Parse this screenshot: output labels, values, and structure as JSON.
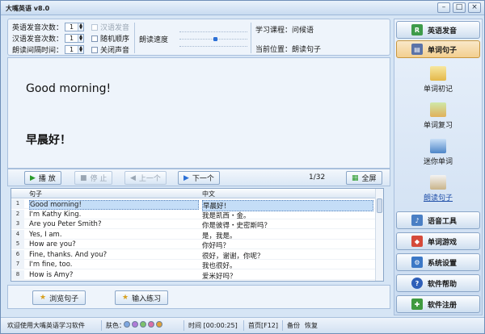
{
  "window": {
    "title": "大嘴英语 v8.0"
  },
  "settings": {
    "en_count_label": "英语发音次数：",
    "en_count": "1",
    "cn_count_label": "汉语发音次数：",
    "cn_count": "1",
    "interval_label": "朗读间隔时间：",
    "interval": "1",
    "chk_cn": "汉语发音",
    "chk_random": "随机顺序",
    "chk_mute": "关闭声音",
    "speed_label": "朗读速度",
    "course_label": "学习课程：问候语",
    "position_label": "当前位置：朗读句子"
  },
  "display": {
    "english": "Good morning!",
    "chinese": "早晨好！"
  },
  "controls": {
    "play": "播 放",
    "stop": "停 止",
    "prev": "上一个",
    "next": "下一个",
    "page": "1/32",
    "fullscreen": "全屏"
  },
  "list": {
    "col_sentence": "句子",
    "col_chinese": "中文",
    "rows": [
      {
        "n": "1",
        "en": "Good morning!",
        "cn": "早晨好！"
      },
      {
        "n": "2",
        "en": "I'm Kathy King.",
        "cn": "我是凯西・金。"
      },
      {
        "n": "3",
        "en": "Are you Peter Smith?",
        "cn": "你是彼得・史密斯吗？"
      },
      {
        "n": "4",
        "en": "Yes, I am.",
        "cn": "是，我是。"
      },
      {
        "n": "5",
        "en": "How are you?",
        "cn": "你好吗？"
      },
      {
        "n": "6",
        "en": "Fine, thanks. And you?",
        "cn": "很好，谢谢，你呢？"
      },
      {
        "n": "7",
        "en": "I'm fine, too.",
        "cn": "我也很好。"
      },
      {
        "n": "8",
        "en": "How is Amy?",
        "cn": "爱米好吗？"
      }
    ]
  },
  "bottom": {
    "browse": "浏览句子",
    "input": "输入练习"
  },
  "sidebar": {
    "en_pron": "英语发音",
    "word_sentence": "单词句子",
    "sub": [
      "单词初记",
      "单词复习",
      "迷你单词",
      "朗读句子"
    ],
    "tools": "语音工具",
    "games": "单词游戏",
    "settings": "系统设置",
    "help": "软件帮助",
    "register": "软件注册"
  },
  "status": {
    "welcome": "欢迎使用大嘴英语学习软件",
    "skin": "肤色：",
    "time": "时间 [00:00:25]",
    "home": "首页[F12]",
    "backup": "备份",
    "restore": "恢复",
    "skin_colors": [
      "#7ea7e0",
      "#b07ad8",
      "#7cc26a",
      "#d86fa8",
      "#e0a23a"
    ]
  }
}
